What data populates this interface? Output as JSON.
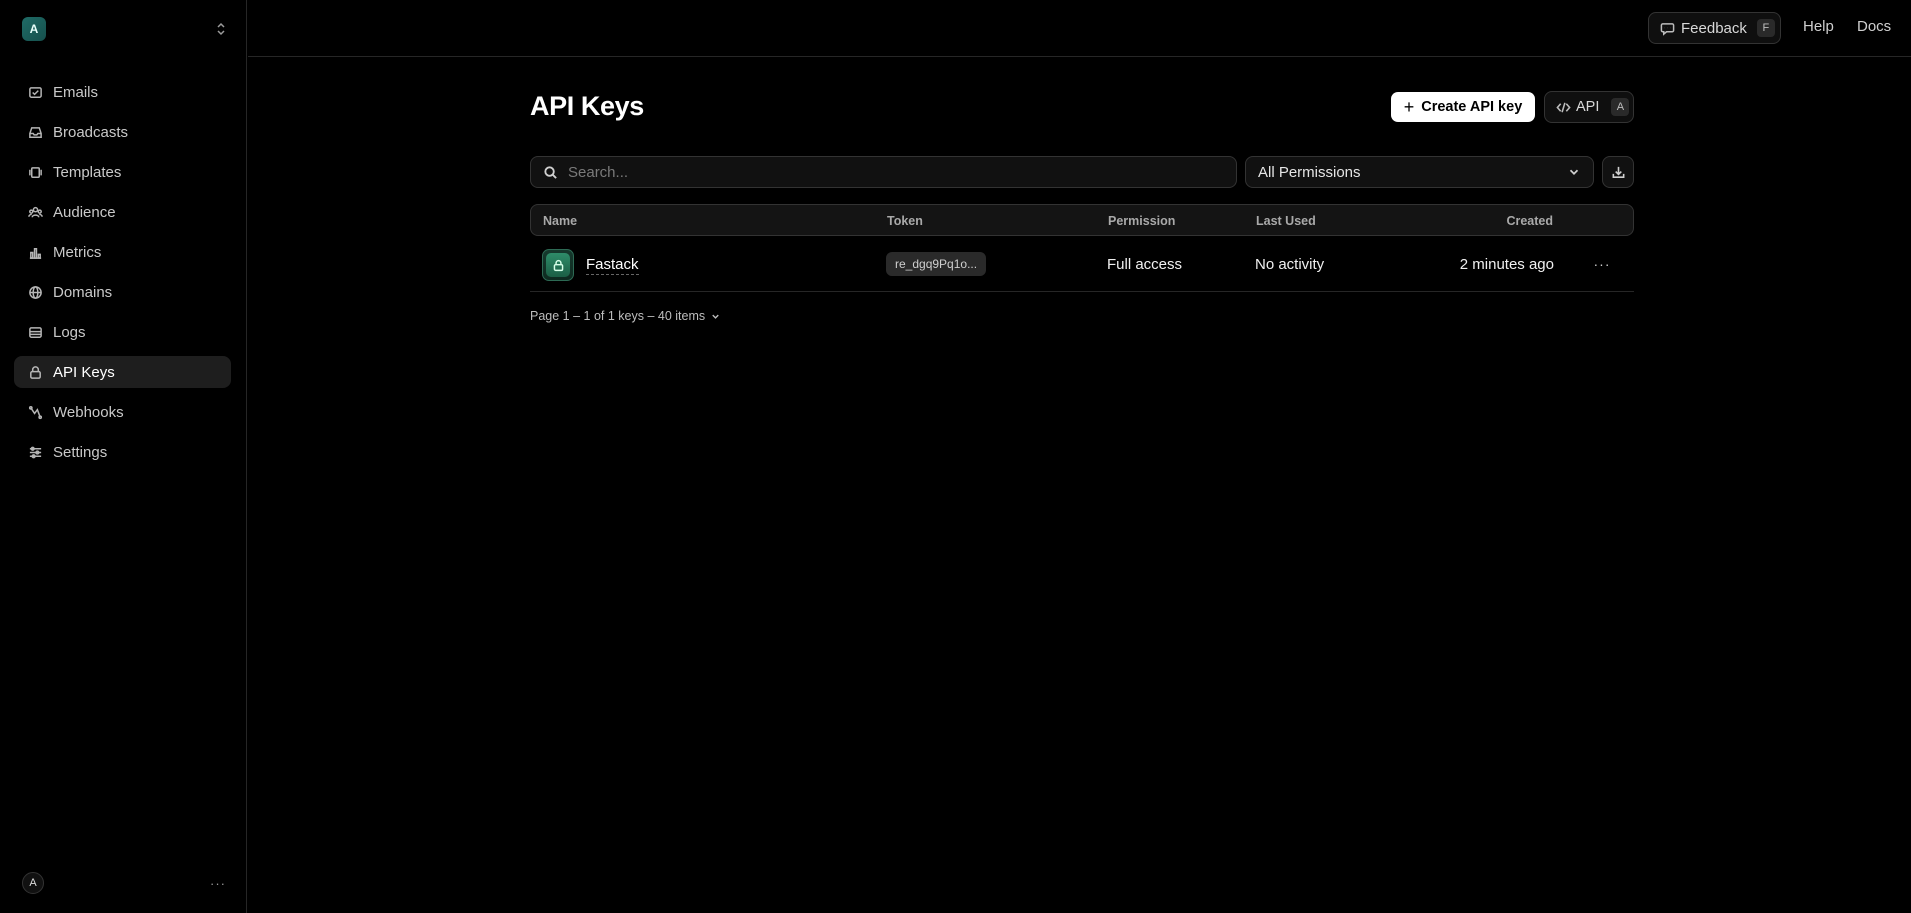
{
  "team": {
    "avatar_letter": "A"
  },
  "sidebar": {
    "items": [
      {
        "label": "Emails",
        "icon": "mail-icon"
      },
      {
        "label": "Broadcasts",
        "icon": "inbox-icon"
      },
      {
        "label": "Templates",
        "icon": "template-icon"
      },
      {
        "label": "Audience",
        "icon": "users-icon"
      },
      {
        "label": "Metrics",
        "icon": "bar-chart-icon"
      },
      {
        "label": "Domains",
        "icon": "globe-icon"
      },
      {
        "label": "Logs",
        "icon": "logs-icon"
      },
      {
        "label": "API Keys",
        "icon": "lock-icon",
        "active": true
      },
      {
        "label": "Webhooks",
        "icon": "webhook-icon"
      },
      {
        "label": "Settings",
        "icon": "sliders-icon"
      }
    ]
  },
  "user": {
    "avatar_letter": "A",
    "more": "···"
  },
  "topbar": {
    "feedback_label": "Feedback",
    "feedback_shortcut": "F",
    "help_label": "Help",
    "docs_label": "Docs"
  },
  "page": {
    "title": "API Keys",
    "create_label": "Create API key",
    "api_label": "API",
    "api_shortcut": "A"
  },
  "filters": {
    "search_placeholder": "Search...",
    "permission_selected": "All Permissions"
  },
  "table": {
    "headers": {
      "name": "Name",
      "token": "Token",
      "permission": "Permission",
      "last_used": "Last Used",
      "created": "Created"
    },
    "rows": [
      {
        "name": "Fastack",
        "token": "re_dgq9Pq1o...",
        "permission": "Full access",
        "last_used": "No activity",
        "created": "2 minutes ago"
      }
    ]
  },
  "pagination": {
    "summary": "Page 1 – 1 of 1 keys – 40 items"
  },
  "colors": {
    "accent": "#2e8c69",
    "background": "#000000"
  }
}
